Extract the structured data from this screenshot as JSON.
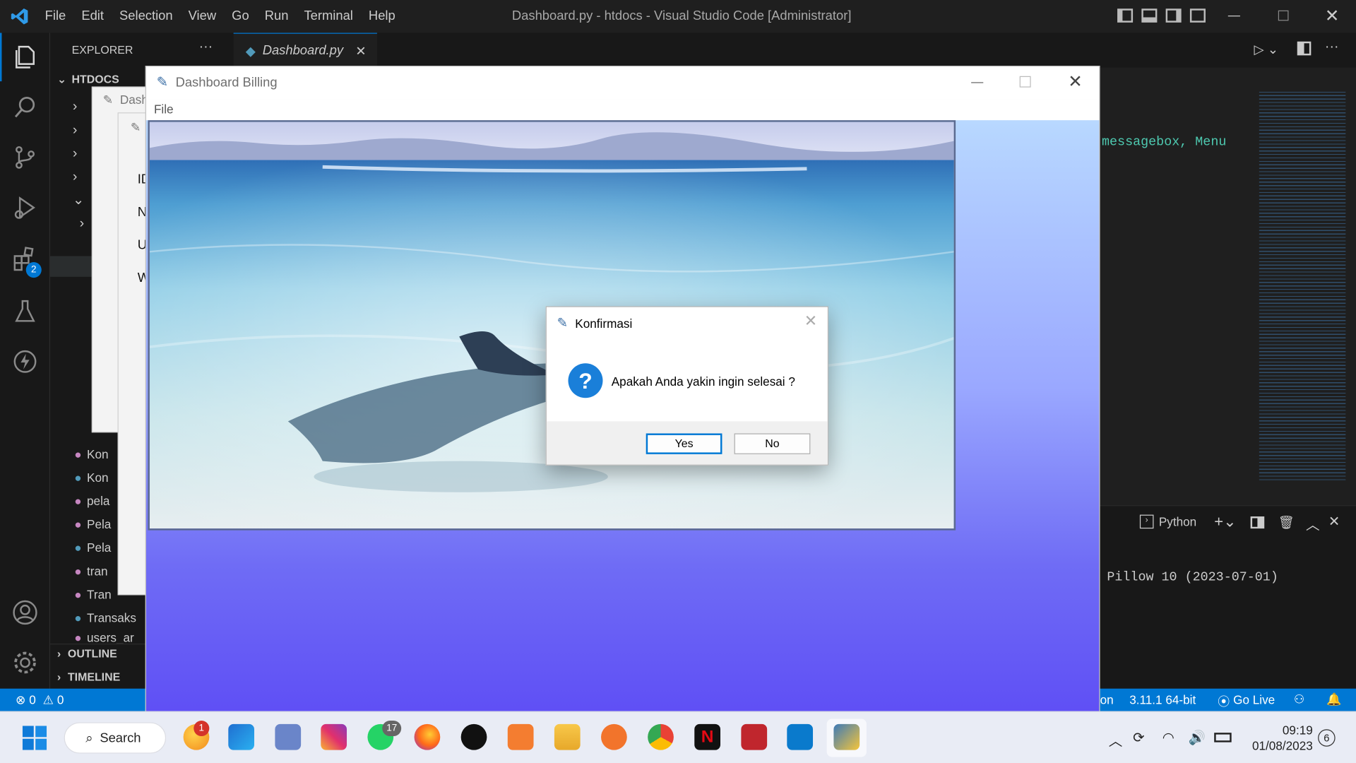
{
  "vscode": {
    "menu": [
      "File",
      "Edit",
      "Selection",
      "View",
      "Go",
      "Run",
      "Terminal",
      "Help"
    ],
    "window_title": "Dashboard.py - htdocs - Visual Studio Code [Administrator]",
    "tab_label": "Dashboard.py",
    "explorer_label": "EXPLORER",
    "explorer_more": "···",
    "folder": "HTDOCS",
    "file_items": [
      "Kon",
      "Kon",
      "pela",
      "Pela",
      "Pela",
      "tran",
      "Tran",
      "Transaks",
      "users_ar"
    ],
    "outline": "OUTLINE",
    "timeline": "TIMELINE",
    "extensions_badge": "2",
    "code_snippet": "messagebox, Menu",
    "terminal_profile": "Python",
    "terminal_output": "Pillow 10 (2023-07-01)",
    "status": {
      "errors": "0",
      "warnings": "0",
      "lang": "on",
      "interpreter": "3.11.1 64-bit",
      "go_live": "Go Live"
    }
  },
  "bg_windows": {
    "title_fragment": "Dash",
    "labels": [
      "ID",
      "N",
      "U",
      "W"
    ]
  },
  "dashboard": {
    "title": "Dashboard Billing",
    "menu_file": "File"
  },
  "dialog": {
    "title": "Konfirmasi",
    "message": "Apakah Anda yakin ingin selesai ?",
    "yes": "Yes",
    "no": "No"
  },
  "taskbar": {
    "search": "Search",
    "badge_1": "1",
    "badge_17": "17",
    "time": "09:19",
    "date": "01/08/2023",
    "notif_count": "6"
  },
  "colors": {
    "status_bar": "#0078d4",
    "dialog_icon": "#1a7fd9"
  }
}
